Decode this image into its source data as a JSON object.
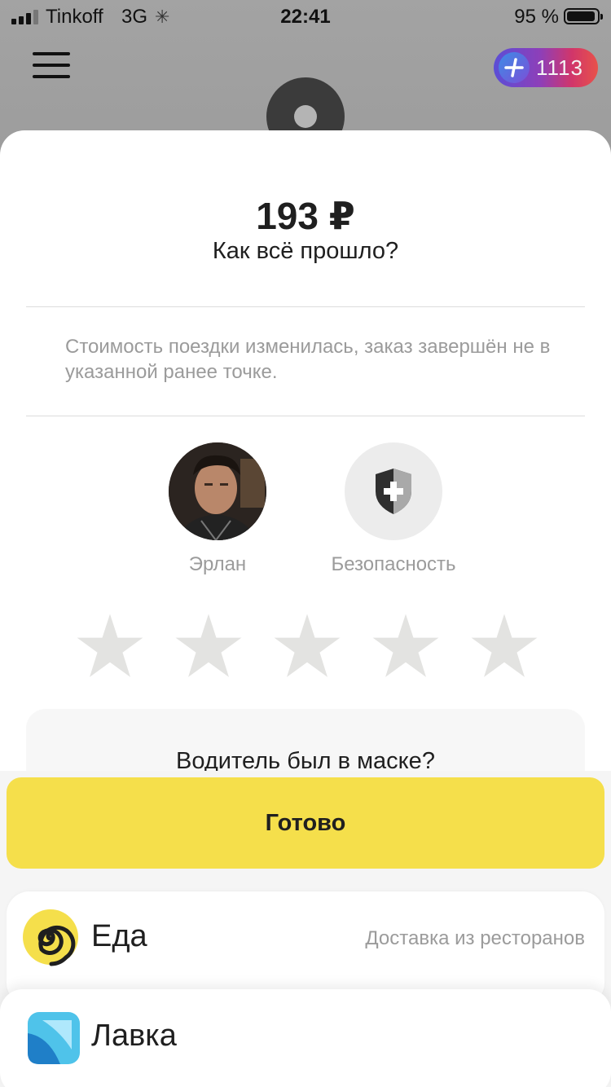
{
  "status_bar": {
    "carrier": "Tinkoff",
    "network": "3G",
    "time": "22:41",
    "battery": "95 %"
  },
  "header": {
    "plus_count": "1113",
    "icons": [
      "menu-icon",
      "plus-icon",
      "map-pin-icon"
    ]
  },
  "trip": {
    "price": "193 ₽",
    "question": "Как всё прошло?",
    "notice": "Стоимость поездки изменилась, заказ завершён не в указанной ранее точке."
  },
  "driver": {
    "name": "Эрлан"
  },
  "safety": {
    "label": "Безопасность",
    "icon": "shield-plus-icon"
  },
  "rating": {
    "max_stars": 5,
    "selected": 0
  },
  "mask_question": "Водитель был в маске?",
  "done_button": "Готово",
  "services": [
    {
      "name": "Еда",
      "subtitle": "Доставка из ресторанов",
      "icon": "eda-spiral-icon"
    },
    {
      "name": "Лавка",
      "subtitle": "",
      "icon": "lavka-icon"
    }
  ],
  "colors": {
    "accent_yellow": "#f5df4b",
    "muted_text": "#9b9b9b",
    "star_empty": "#e3e3e1"
  }
}
